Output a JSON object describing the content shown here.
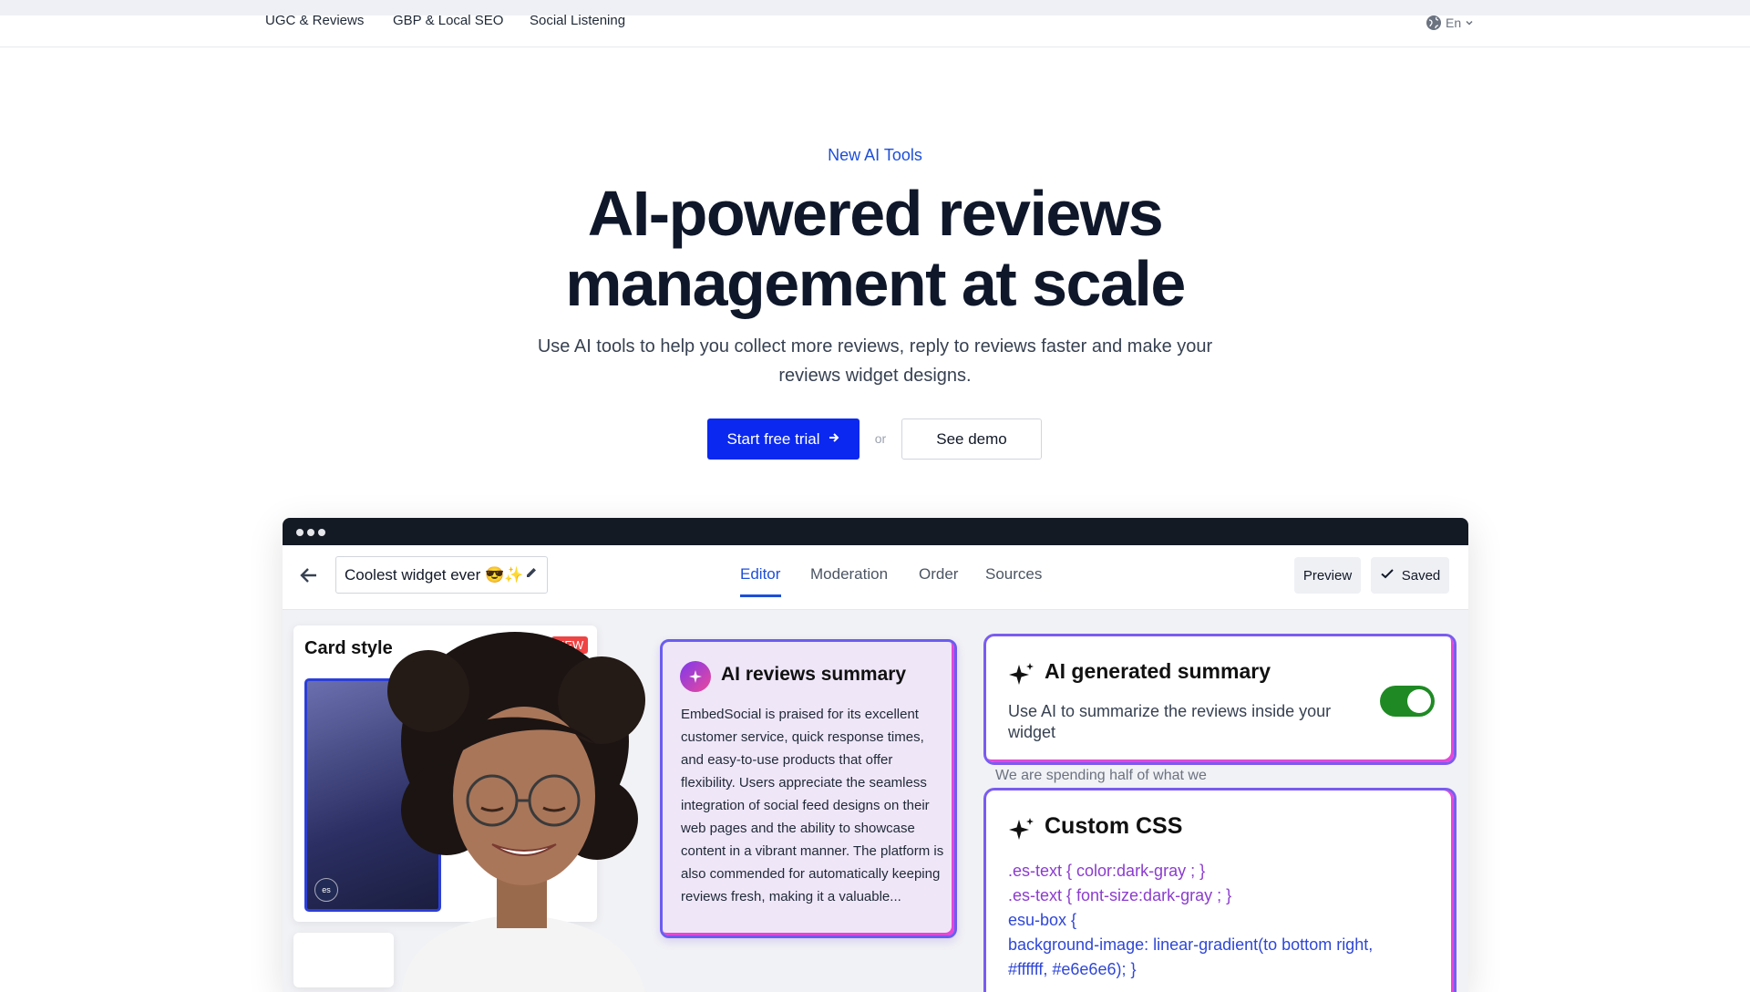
{
  "nav": {
    "items": [
      "UGC & Reviews",
      "GBP & Local SEO",
      "Social Listening"
    ],
    "language": "En"
  },
  "hero": {
    "eyebrow": "New AI Tools",
    "headline_line1": "AI-powered reviews",
    "headline_line2": "management at scale",
    "subtext": "Use AI tools to help you collect more reviews, reply to reviews faster and make your reviews widget designs.",
    "cta_primary": "Start free trial",
    "or": "or",
    "cta_secondary": "See demo"
  },
  "mockup": {
    "widget_name": "Coolest widget ever 😎✨",
    "tabs": [
      "Editor",
      "Moderation",
      "Order",
      "Sources"
    ],
    "active_tab": "Editor",
    "preview_label": "Preview",
    "saved_label": "Saved",
    "card_style": {
      "title": "Card style",
      "badge": "NEW"
    },
    "ai_summary": {
      "title": "AI reviews summary",
      "body": "EmbedSocial is praised for its excellent customer service, quick response times, and easy-to-use products that offer flexibility. Users appreciate the seamless integration of social feed designs on their web pages and the ability to showcase content in a vibrant manner. The platform is also commended for automatically keeping reviews fresh, making it a valuable..."
    },
    "ai_generated": {
      "title": "AI generated summary",
      "description": "Use AI to summarize the reviews inside your widget",
      "toggle_on": true
    },
    "behind_text": "We are spending half of what we previously did for a select review",
    "custom_css": {
      "title": "Custom CSS",
      "lines": [
        ".es-text { color:dark-gray ; }",
        ".es-text { font-size:dark-gray ; }",
        "esu-box {",
        "background-image: linear-gradient(to bottom right,",
        "#ffffff, #e6e6e6); }"
      ]
    }
  },
  "colors": {
    "primary": "#0a28f0",
    "accent_link": "#1d4ed8",
    "toggle_on": "#1f8a24",
    "card_border_gradient": [
      "#6b5cf0",
      "#e546d8"
    ]
  }
}
